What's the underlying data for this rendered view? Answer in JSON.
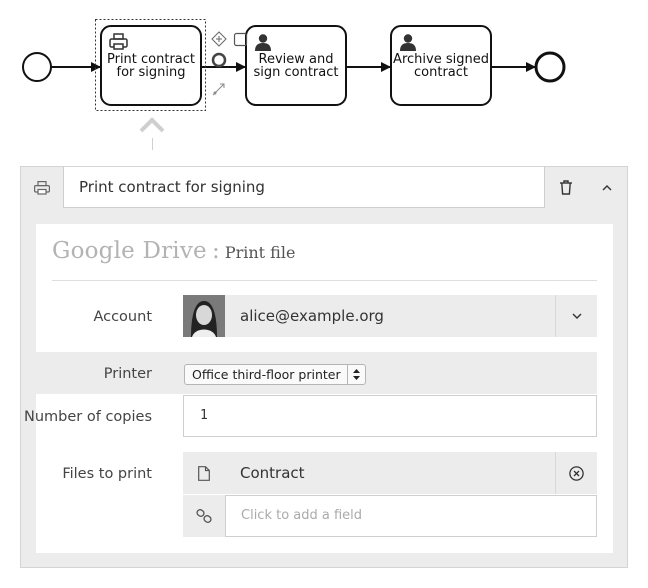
{
  "diagram": {
    "tasks": [
      {
        "line1": "Print contract",
        "line2": "for signing",
        "icon": "printer-icon"
      },
      {
        "line1": "Review and",
        "line2": "sign contract",
        "icon": "user-icon"
      },
      {
        "line1": "Archive signed",
        "line2": "contract",
        "icon": "user-icon"
      }
    ]
  },
  "panel": {
    "header_icon": "printer-icon",
    "title": "Print contract for signing",
    "delete_icon": "trash-icon",
    "collapse_icon": "chevron-up-icon"
  },
  "card": {
    "service": "Google Drive",
    "separator": ":",
    "action": "Print file",
    "account": {
      "label": "Account",
      "value": "alice@example.org",
      "dropdown_icon": "chevron-down-icon"
    },
    "printer": {
      "label": "Printer",
      "selected": "Office third-floor printer"
    },
    "copies": {
      "label": "Number of copies",
      "value": "1"
    },
    "files": {
      "label": "Files to print",
      "file_name": "Contract",
      "file_icon": "file-icon",
      "remove_icon": "remove-circle-icon",
      "link_icon": "link-icon",
      "add_placeholder": "Click to add a field"
    }
  },
  "colors": {
    "panel_bg": "#ececec",
    "card_bg": "#ffffff",
    "border": "#cfcfcf",
    "stroke": "#111111"
  }
}
